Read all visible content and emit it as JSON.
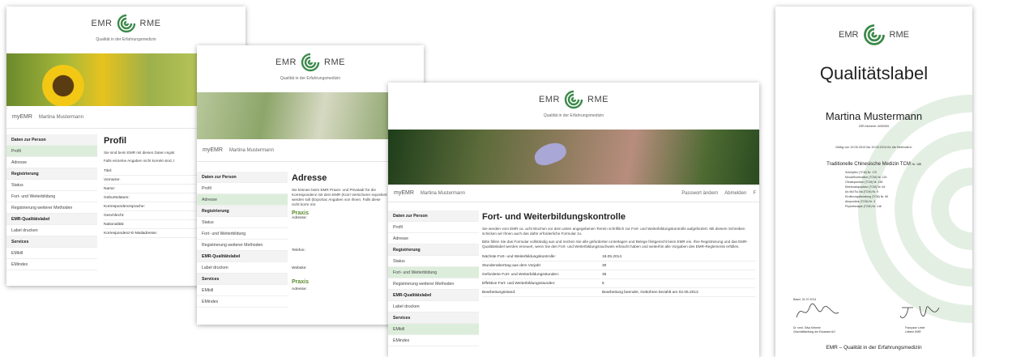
{
  "brand": {
    "emr": "EMR",
    "rme": "RME",
    "tagline": "Qualität in der Erfahrungsmedizin"
  },
  "user": {
    "app": "myEMR",
    "name": "Martina Mustermann"
  },
  "topnav": {
    "password": "Passwort ändern",
    "logout": "Abmelden",
    "extra": "F"
  },
  "nav": {
    "cat_person": "Daten zur Person",
    "profil": "Profil",
    "adresse": "Adresse",
    "cat_reg": "Registrierung",
    "status": "Status",
    "fort": "Fort- und Weiterbildung",
    "reg_methods": "Registrierung weiterer Methoden",
    "cat_label": "EMR-Qualitätslabel",
    "label_print": "Label drucken",
    "cat_services": "Services",
    "embill": "EMbill",
    "emindex": "EMindex"
  },
  "profile": {
    "title": "Profil",
    "intro": "Sie sind beim EMR mit diesen Daten regist",
    "note": "Falls einzelne Angaben nicht korrekt sind, t",
    "fields": [
      "Titel:",
      "Vorname:",
      "Name:",
      "Geburtsdatum:",
      "Korrespondenzsprache:",
      "Geschlecht:",
      "Nationalität:",
      "Korrespondenz-E-Mailadresse:"
    ]
  },
  "address": {
    "title": "Adresse",
    "intro": "Sie können beim EMR Praxis- und Privatadr für die Korrespondenz mit dem EMR (Korri Versicherer exportiert werden soll (Exportac Angaben von Ihnen. Falls diese nicht korre mit.",
    "praxis": "Praxis",
    "adresse": "Adresse:",
    "telefon": "Telefon:",
    "website": "Website:",
    "praxis2": "Praxis",
    "adresse2": "Adresse:"
  },
  "training": {
    "title": "Fort- und Weiterbildungskontrolle",
    "p1": "Sie werden vom EMR ca. acht Wochen vor dem unten angegebenen Termin schriftlich zur Fort- und Weiterbildungskontrolle aufgefordert. Mit diesem Schreiben schicken wir Ihnen auch das dafür erforderliche Formular zu.",
    "p2": "Bitte füllen Sie das Formular vollständig aus und reichen Sie alle geforderten Unterlagen und Belege fristgerecht beim EMR ein. Ihre Registrierung und das EMR-Qualitätslabel werden erneuert, wenn Sie den Fort- und Weiterbildungsnachweis erbracht haben und weiterhin alle Vorgaben des EMR-Reglements erfüllen.",
    "rows": [
      {
        "k": "Nächste Fort- und Weiterbildungskontrolle:",
        "v": "19.05.2014"
      },
      {
        "k": "Stundenübertrag aus dem Vorjahr:",
        "v": "30"
      },
      {
        "k": "Geforderte Fort- und Weiterbildungsstunden:",
        "v": "35"
      },
      {
        "k": "Effektive Fort- und Weiterbildungsstunden:",
        "v": "5"
      },
      {
        "k": "Bearbeitungsstand:",
        "v": "Bearbeitung beendet, Gebühren bezahlt am 02.05.2013"
      }
    ]
  },
  "certificate": {
    "title": "Qualitätslabel",
    "name": "Martina Mustermann",
    "zsr": "ZSR-Nummer: A000000",
    "valid": "Gültig von 19.05.2013 bis 19.05.2014 für die Methode/n:",
    "method": "Traditionelle Chinesische Medizin TCM",
    "method_nr": "Nr. 185",
    "sub": [
      "Schröpfen (TCM) Nr. 170",
      "Moxa/Moxibustion (TCM) Nr. 124",
      "Ohrakupunktur (TCM) Nr. 138",
      "Elektroakupunktur (TCM) Nr. 64",
      "An-Mo/Tui-Na (TCM) Nr. 9",
      "Ernährungsberatung (TCM) Nr. 69",
      "Akupunktur (TCM) Nr. 3",
      "Phytotherapie (TCM) Nr. 146"
    ],
    "place_date": "Basel, 31.07.2014",
    "sig1_name": "Dr. med. Silva Keberle",
    "sig1_role": "Geschäftsleitung der Eskamed AG",
    "sig2_name": "Françoise Lebet",
    "sig2_role": "Leiterin EMR",
    "footer": "EMR – Qualität in der Erfahrungsmedizin"
  },
  "colors": {
    "accent": "#3c8a4a",
    "nav_active": "#dceedb",
    "section": "#5a8a2e"
  }
}
